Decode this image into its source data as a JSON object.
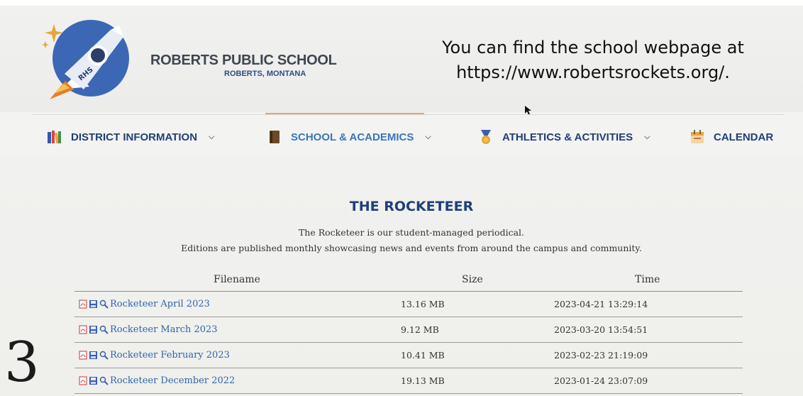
{
  "header": {
    "school_name": "ROBERTS PUBLIC SCHOOL",
    "school_location": "ROBERTS, MONTANA",
    "logo_text": "RHS"
  },
  "caption": {
    "line1": "You can find the school webpage at",
    "line2": "https://www.robertsrockets.org/."
  },
  "nav": {
    "items": [
      {
        "label": "DISTRICT INFORMATION",
        "icon": "books-icon",
        "has_dropdown": true
      },
      {
        "label": "SCHOOL & ACADEMICS",
        "icon": "book-icon",
        "has_dropdown": true,
        "active": true
      },
      {
        "label": "ATHLETICS & ACTIVITIES",
        "icon": "medal-icon",
        "has_dropdown": true
      },
      {
        "label": "CALENDAR",
        "icon": "calendar-icon",
        "has_dropdown": false
      }
    ]
  },
  "main": {
    "title": "THE ROCKETEER",
    "intro_line1": "The Rocketeer is our student-managed periodical.",
    "intro_line2": "Editions are published monthly showcasing news and events from around the campus and community."
  },
  "table": {
    "columns": [
      "Filename",
      "Size",
      "Time"
    ],
    "rows": [
      {
        "filename": "Rocketeer April 2023",
        "size": "13.16 MB",
        "time": "2023-04-21 13:29:14"
      },
      {
        "filename": "Rocketeer March 2023",
        "size": "9.12 MB",
        "time": "2023-03-20 13:54:51"
      },
      {
        "filename": "Rocketeer February 2023",
        "size": "10.41 MB",
        "time": "2023-02-23 21:19:09"
      },
      {
        "filename": "Rocketeer December 2022",
        "size": "19.13 MB",
        "time": "2023-01-24 23:07:09"
      }
    ],
    "row_icons": [
      "pdf-icon",
      "save-icon",
      "preview-icon"
    ]
  },
  "overlay_number": "3",
  "colors": {
    "nav_text": "#1f3f79",
    "nav_active": "#3a76b8",
    "link": "#2f66a8",
    "accent_line": "#e8a46c",
    "background": "#f3f3f1"
  }
}
